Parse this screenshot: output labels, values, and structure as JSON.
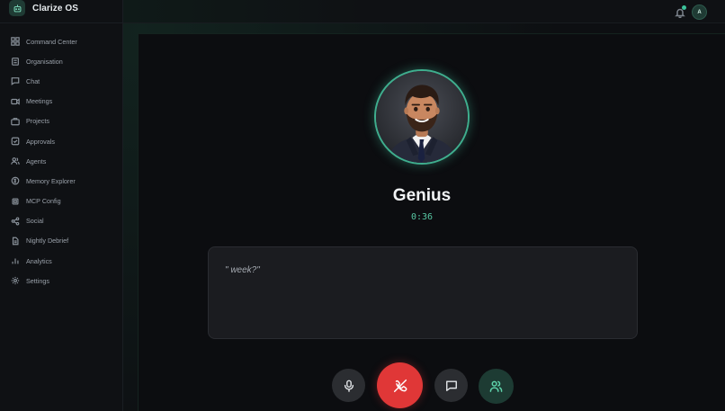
{
  "app": {
    "title": "Clarize OS"
  },
  "sidebar": {
    "items": [
      {
        "label": "Command Center",
        "icon": "grid-icon"
      },
      {
        "label": "Organisation",
        "icon": "building-icon"
      },
      {
        "label": "Chat",
        "icon": "chat-icon"
      },
      {
        "label": "Meetings",
        "icon": "video-icon"
      },
      {
        "label": "Projects",
        "icon": "briefcase-icon"
      },
      {
        "label": "Approvals",
        "icon": "check-square-icon"
      },
      {
        "label": "Agents",
        "icon": "users-icon"
      },
      {
        "label": "Memory Explorer",
        "icon": "memory-icon"
      },
      {
        "label": "MCP Config",
        "icon": "chip-icon"
      },
      {
        "label": "Social",
        "icon": "share-icon"
      },
      {
        "label": "Nightly Debrief",
        "icon": "document-icon"
      },
      {
        "label": "Analytics",
        "icon": "bar-chart-icon"
      },
      {
        "label": "Settings",
        "icon": "gear-icon"
      }
    ]
  },
  "header": {
    "avatar_initial": "A",
    "notification_dot": true
  },
  "call": {
    "name": "Genius",
    "time": "0:36",
    "transcript": "\" week?\""
  },
  "colors": {
    "accent": "#3fae8e",
    "end_call": "#e03737",
    "background": "#0c0d10"
  }
}
